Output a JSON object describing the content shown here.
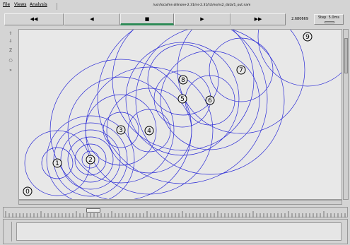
{
  "menu": {
    "file": "File",
    "views": "Views",
    "analysis": "Analysis",
    "path": "/usr/local/ns-allinone-2.31/ns-2.31/tcl/ex/ns2_data/1_out.nam"
  },
  "controls": {
    "rewind": "◀◀",
    "back": "◀",
    "stop": "■",
    "play": "▶",
    "fastforward": "▶▶",
    "time": "2.680669",
    "step": "Step: 5.0ms"
  },
  "tools": [
    "zoom-in-icon",
    "zoom-out-icon",
    "zoom-fit-icon",
    "circle-icon",
    "arrow-icon"
  ],
  "tool_glyphs": [
    "⇧",
    "⇩",
    "Z",
    "○",
    "»"
  ],
  "nodes": [
    {
      "id": "0",
      "color": "#000000"
    },
    {
      "id": "1",
      "color": "#000000"
    },
    {
      "id": "2",
      "color": "#000000"
    },
    {
      "id": "3",
      "color": "#000000"
    },
    {
      "id": "4",
      "color": "#000000"
    },
    {
      "id": "5",
      "color": "#000000"
    },
    {
      "id": "6",
      "color": "#000000"
    },
    {
      "id": "7",
      "color": "#000000"
    },
    {
      "id": "8",
      "color": "#000000"
    },
    {
      "id": "9",
      "color": "#000000"
    }
  ],
  "colors": {
    "wave": "#2b2bd6",
    "canvas_bg": "#e8e8e8",
    "play_indicator": "#2e8b57"
  }
}
